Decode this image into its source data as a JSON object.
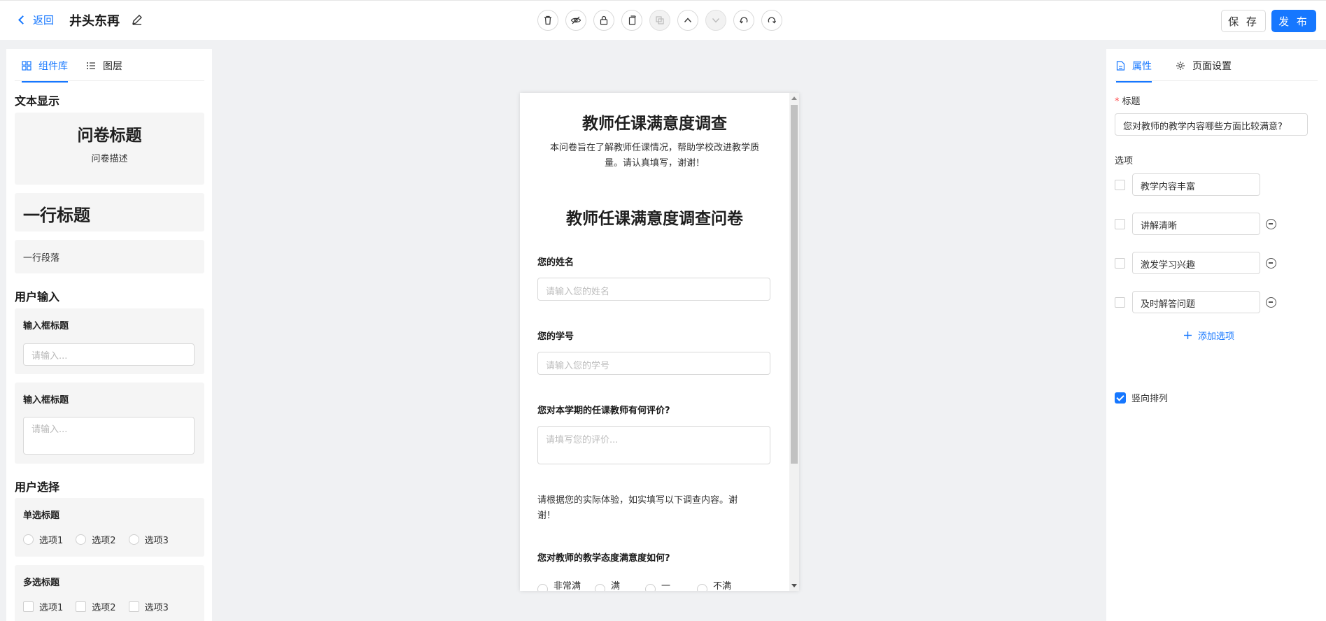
{
  "header": {
    "back_label": "返回",
    "project_title": "井头东再",
    "save_label": "保 存",
    "publish_label": "发 布",
    "accent_color": "#1677ff"
  },
  "toolbar": {
    "tools": [
      {
        "name": "delete-icon",
        "disabled": false
      },
      {
        "name": "hide-icon",
        "disabled": false
      },
      {
        "name": "lock-icon",
        "disabled": false
      },
      {
        "name": "copy-icon",
        "disabled": false
      },
      {
        "name": "duplicate-icon",
        "disabled": true
      },
      {
        "name": "move-up-icon",
        "disabled": false
      },
      {
        "name": "move-down-icon",
        "disabled": true
      },
      {
        "name": "undo-icon",
        "disabled": false
      },
      {
        "name": "redo-icon",
        "disabled": false
      }
    ]
  },
  "left_panel": {
    "tabs": [
      "组件库",
      "图层"
    ],
    "active_tab": "组件库",
    "sections": {
      "text_display": "文本显示",
      "user_input": "用户输入",
      "user_select": "用户选择"
    },
    "text_components": {
      "survey_title": "问卷标题",
      "survey_desc": "问卷描述",
      "line_title": "一行标题",
      "line_paragraph": "一行段落"
    },
    "input_components": {
      "input_title_1": "输入框标题",
      "input_placeholder_1": "请输入...",
      "input_title_2": "输入框标题",
      "input_placeholder_2": "请输入..."
    },
    "select_components": {
      "radio_title": "单选标题",
      "radio_options": [
        "选项1",
        "选项2",
        "选项3"
      ],
      "checkbox_title": "多选标题",
      "checkbox_options": [
        "选项1",
        "选项2",
        "选项3"
      ]
    }
  },
  "canvas": {
    "survey_title": "教师任课满意度调查",
    "survey_desc_line1": "本问卷旨在了解教师任课情况，帮助学校改进教学质",
    "survey_desc_line2": "量。请认真填写，谢谢！",
    "heading": "教师任课满意度调查问卷",
    "q_name_label": "您的姓名",
    "q_name_placeholder": "请输入您的姓名",
    "q_id_label": "您的学号",
    "q_id_placeholder": "请输入您的学号",
    "q_eval_label": "您对本学期的任课教师有何评价?",
    "q_eval_placeholder": "请填写您的评价...",
    "paragraph_line1": "请根据您的实际体验，如实填写以下调查内容。谢",
    "paragraph_line2": "谢！",
    "q_attitude_label": "您对教师的教学态度满意度如何?",
    "q_attitude_options": [
      "非常满",
      "满",
      "一",
      "不满"
    ]
  },
  "right_panel": {
    "tabs": [
      "属性",
      "页面设置"
    ],
    "active_tab": "属性",
    "title_label": "标题",
    "title_value": "您对教师的教学内容哪些方面比较满意?",
    "options_label": "选项",
    "options": [
      "教学内容丰富",
      "讲解清晰",
      "激发学习兴趣",
      "及时解答问题"
    ],
    "add_option_label": "添加选项",
    "vertical_label": "竖向排列",
    "vertical_checked": true
  }
}
